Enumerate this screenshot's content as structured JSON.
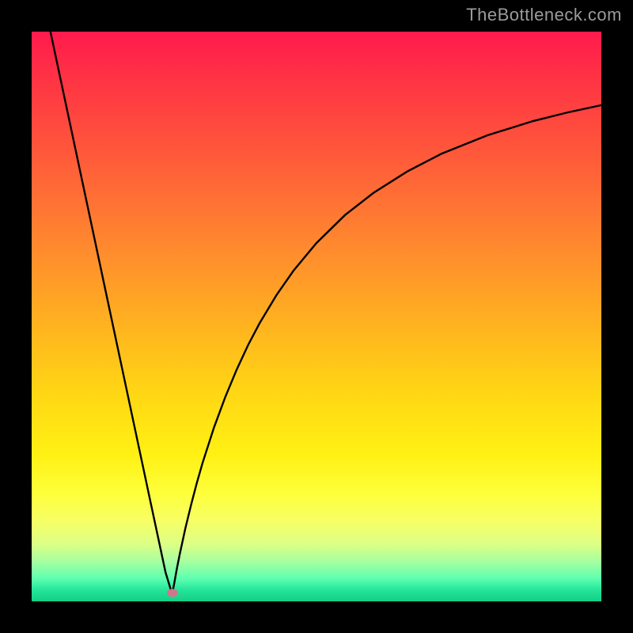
{
  "watermark": {
    "text": "TheBottleneck.com"
  },
  "chart_data": {
    "type": "line",
    "title": "",
    "xlabel": "",
    "ylabel": "",
    "xlim": [
      0,
      100
    ],
    "ylim": [
      0,
      100
    ],
    "grid": false,
    "legend": false,
    "background": "rainbow-gradient",
    "marker": {
      "x": 24.7,
      "y": 1.5,
      "color": "#d1758c"
    },
    "series": [
      {
        "name": "left-branch",
        "x": [
          3.3,
          5,
          7,
          9,
          11,
          13,
          15,
          17,
          19,
          21,
          22.5,
          23.5,
          24.5
        ],
        "values": [
          100,
          92,
          82.6,
          73.2,
          63.8,
          54.4,
          45,
          35.6,
          26.2,
          16.8,
          9.8,
          5.1,
          1.8
        ]
      },
      {
        "name": "right-branch",
        "x": [
          24.7,
          25,
          25.5,
          26,
          27,
          28,
          29,
          30,
          32,
          34,
          36,
          38,
          40,
          43,
          46,
          50,
          55,
          60,
          66,
          72,
          80,
          88,
          94,
          100
        ],
        "values": [
          1.5,
          3.0,
          5.8,
          8.3,
          12.9,
          17.0,
          20.8,
          24.3,
          30.5,
          35.9,
          40.7,
          45.0,
          48.8,
          53.8,
          58.1,
          62.9,
          67.8,
          71.7,
          75.5,
          78.6,
          81.8,
          84.3,
          85.8,
          87.1
        ]
      }
    ]
  }
}
